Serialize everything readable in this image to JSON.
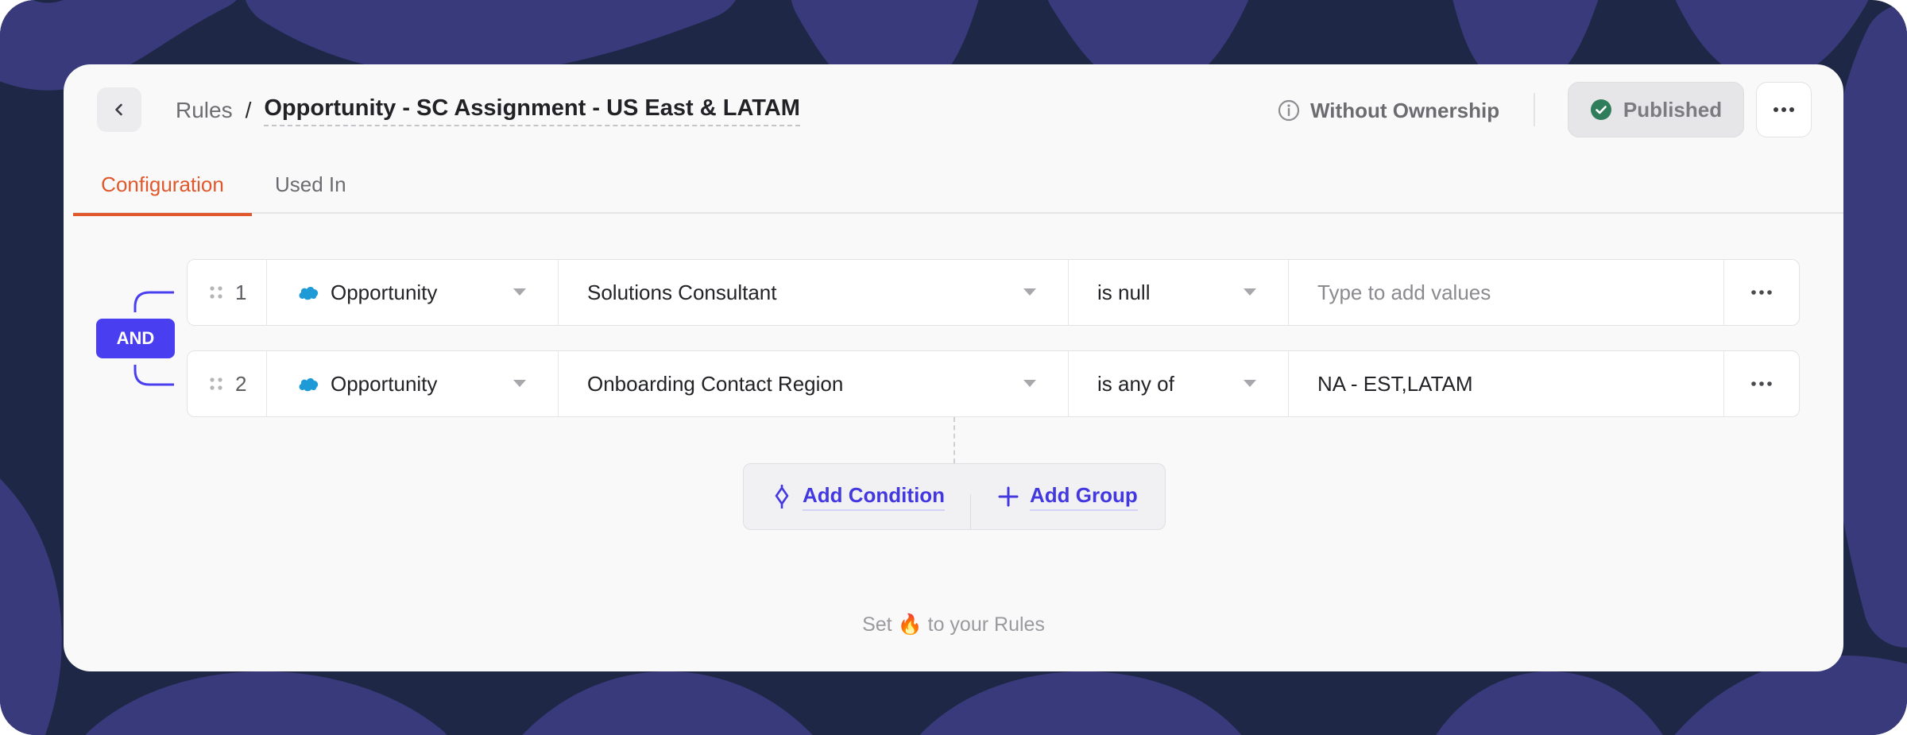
{
  "header": {
    "back_icon": "chevron-left-icon",
    "breadcrumb_root": "Rules",
    "breadcrumb_sep": "/",
    "title": "Opportunity - SC Assignment - US East & LATAM",
    "ownership_icon": "info-icon",
    "ownership_label": "Without Ownership",
    "status_icon": "check-circle-icon",
    "status_label": "Published",
    "status_color": "#2f7d5b",
    "more_icon": "more-horizontal-icon"
  },
  "tabs": [
    {
      "label": "Configuration",
      "active": true
    },
    {
      "label": "Used In",
      "active": false
    }
  ],
  "logic": {
    "operator": "AND",
    "accent": "#4a3ff0"
  },
  "conditions": [
    {
      "index": "1",
      "object": "Opportunity",
      "object_icon": "salesforce-cloud-icon",
      "field": "Solutions Consultant",
      "operator": "is null",
      "value": "",
      "value_placeholder": "Type to add values"
    },
    {
      "index": "2",
      "object": "Opportunity",
      "object_icon": "salesforce-cloud-icon",
      "field": "Onboarding Contact Region",
      "operator": "is any of",
      "value": "NA - EST,LATAM",
      "value_placeholder": ""
    }
  ],
  "actions": {
    "add_condition": "Add Condition",
    "add_group": "Add Group"
  },
  "footer": {
    "before": "Set",
    "emoji": "🔥",
    "after": "to your Rules"
  },
  "colors": {
    "tab_active": "#e0582b",
    "link": "#4338e0",
    "background": "#1f2747",
    "background_stripe": "#3a3a7a"
  }
}
